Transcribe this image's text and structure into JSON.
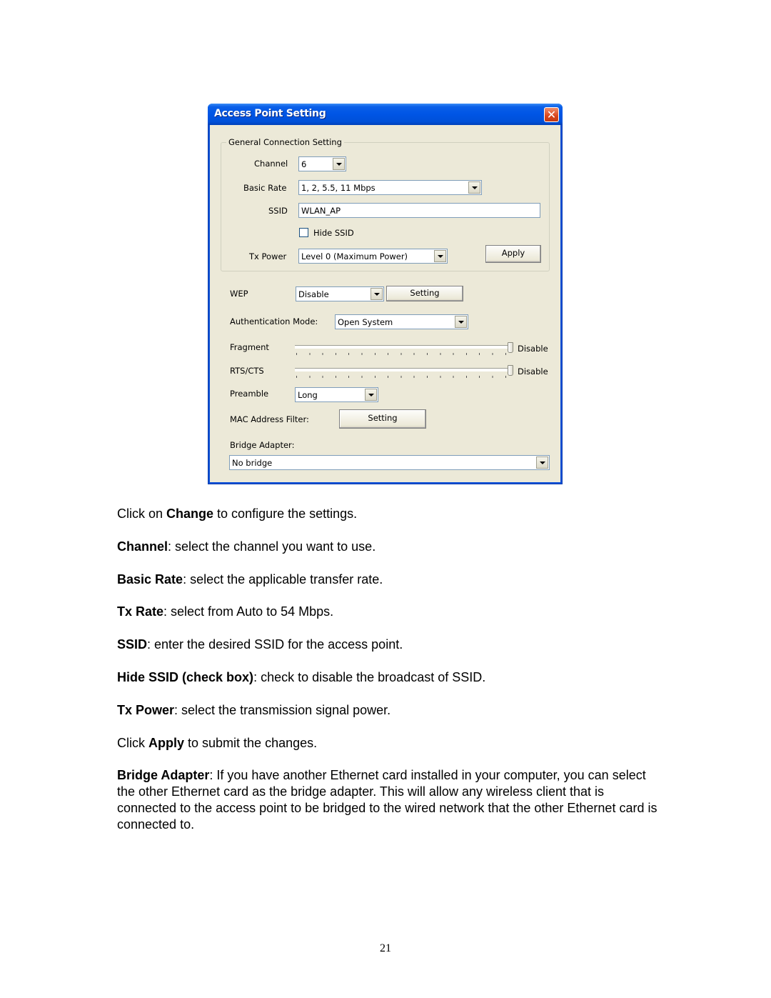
{
  "dialog": {
    "title": "Access Point Setting",
    "close_glyph": "✕",
    "general": {
      "group_title": "General Connection Setting",
      "channel_label": "Channel",
      "channel_value": "6",
      "basic_rate_label": "Basic Rate",
      "basic_rate_value": "1, 2, 5.5, 11 Mbps",
      "ssid_label": "SSID",
      "ssid_value": "WLAN_AP",
      "hide_ssid_label": "Hide SSID",
      "hide_ssid_checked": false,
      "tx_power_label": "Tx Power",
      "tx_power_value": "Level 0 (Maximum Power)",
      "apply_label": "Apply"
    },
    "wep_label": "WEP",
    "wep_value": "Disable",
    "wep_setting_label": "Setting",
    "auth_label": "Authentication Mode:",
    "auth_value": "Open System",
    "fragment_label": "Fragment",
    "fragment_value_text": "Disable",
    "fragment_position": 1.0,
    "rts_label": "RTS/CTS",
    "rts_value_text": "Disable",
    "rts_position": 1.0,
    "preamble_label": "Preamble",
    "preamble_value": "Long",
    "mac_filter_label": "MAC Address Filter:",
    "mac_filter_button": "Setting",
    "bridge_label": "Bridge Adapter:",
    "bridge_value": "No bridge"
  },
  "doc": {
    "p1": {
      "pre": "Click on ",
      "bold": "Change",
      "post": " to configure the settings."
    },
    "p2": {
      "bold": "Channel",
      "post": ": select the channel you want to use."
    },
    "p3": {
      "bold": "Basic Rate",
      "post": ": select the applicable transfer rate."
    },
    "p4": {
      "bold": "Tx Rate",
      "post": ": select from Auto to 54 Mbps."
    },
    "p5": {
      "bold": "SSID",
      "post": ": enter the desired SSID for the access point."
    },
    "p6": {
      "bold": "Hide SSID (check box)",
      "post": ": check to disable the broadcast of SSID."
    },
    "p7": {
      "bold": "Tx Power",
      "post": ": select the transmission signal power."
    },
    "p8": {
      "pre": "Click ",
      "bold": "Apply",
      "post": " to submit the changes."
    },
    "p9": {
      "bold": "Bridge Adapter",
      "post": ": If you have another Ethernet card installed in your computer, you can select the other Ethernet card as the bridge adapter. This will allow any wireless client that is connected to the access point to be bridged to the wired network that the other Ethernet card is connected to."
    }
  },
  "page_number": "21"
}
